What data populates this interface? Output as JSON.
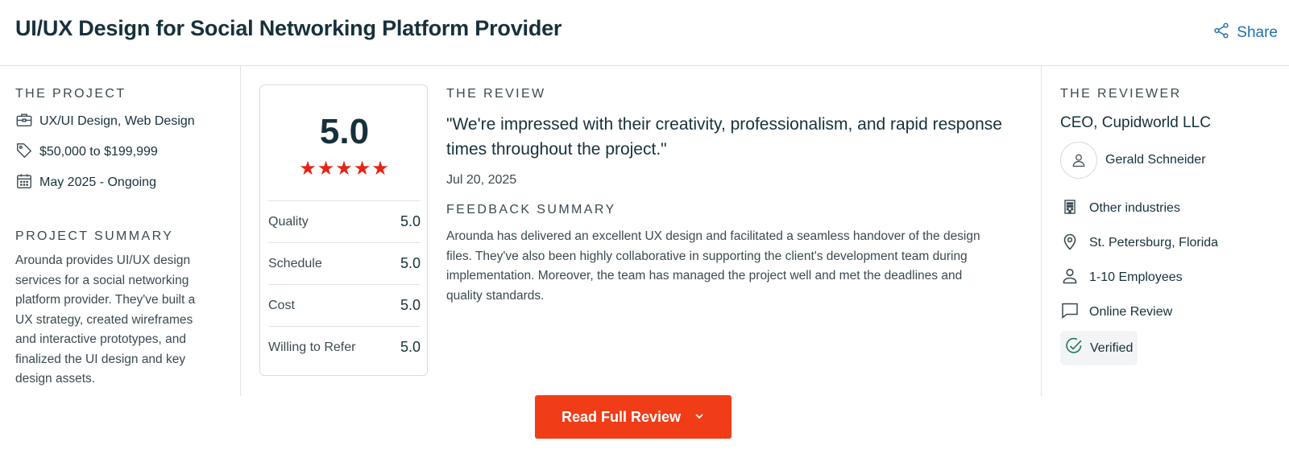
{
  "header": {
    "title": "UI/UX Design for Social Networking Platform Provider",
    "share_label": "Share"
  },
  "project": {
    "section_label": "THE PROJECT",
    "services": "UX/UI Design, Web Design",
    "budget": "$50,000 to $199,999",
    "timeline": "May 2025 - Ongoing",
    "summary_label": "PROJECT SUMMARY",
    "summary_lines": [
      "Arounda provides UI/UX design",
      "services for a social networking",
      "platform provider. They've built a",
      "UX strategy, created wireframes",
      "and interactive prototypes, and",
      "finalized the UI design and key",
      "design assets."
    ]
  },
  "rating": {
    "overall": "5.0",
    "stars": "★★★★★",
    "star_count": 5,
    "rows": [
      {
        "label": "Quality",
        "value": "5.0"
      },
      {
        "label": "Schedule",
        "value": "5.0"
      },
      {
        "label": "Cost",
        "value": "5.0"
      },
      {
        "label": "Willing to Refer",
        "value": "5.0"
      }
    ]
  },
  "review": {
    "section_label": "THE REVIEW",
    "quote_line1": "\"We're impressed with their creativity, professionalism, and rapid response",
    "quote_line2": "times throughout the project.\"",
    "date": "Jul 20, 2025",
    "feedback_label": "FEEDBACK SUMMARY",
    "feedback_lines": [
      "Arounda has delivered an excellent UX design and facilitated a seamless handover of the design",
      "files. They've also been highly collaborative in supporting the client's development team during",
      "implementation. Moreover, the team has managed the project well and met the deadlines and",
      "quality standards."
    ]
  },
  "reviewer": {
    "section_label": "THE REVIEWER",
    "role": "CEO, Cupidworld LLC",
    "name": "Gerald Schneider",
    "industry": "Other industries",
    "location": "St. Petersburg, Florida",
    "size": "1-10 Employees",
    "review_type": "Online Review",
    "verified_label": "Verified"
  },
  "cta": {
    "label": "Read Full Review"
  },
  "colors": {
    "accent": "#f03d17",
    "star": "#e62415",
    "link": "#1f6fb2",
    "verified": "#1e7a5a",
    "text": "#17313b"
  }
}
